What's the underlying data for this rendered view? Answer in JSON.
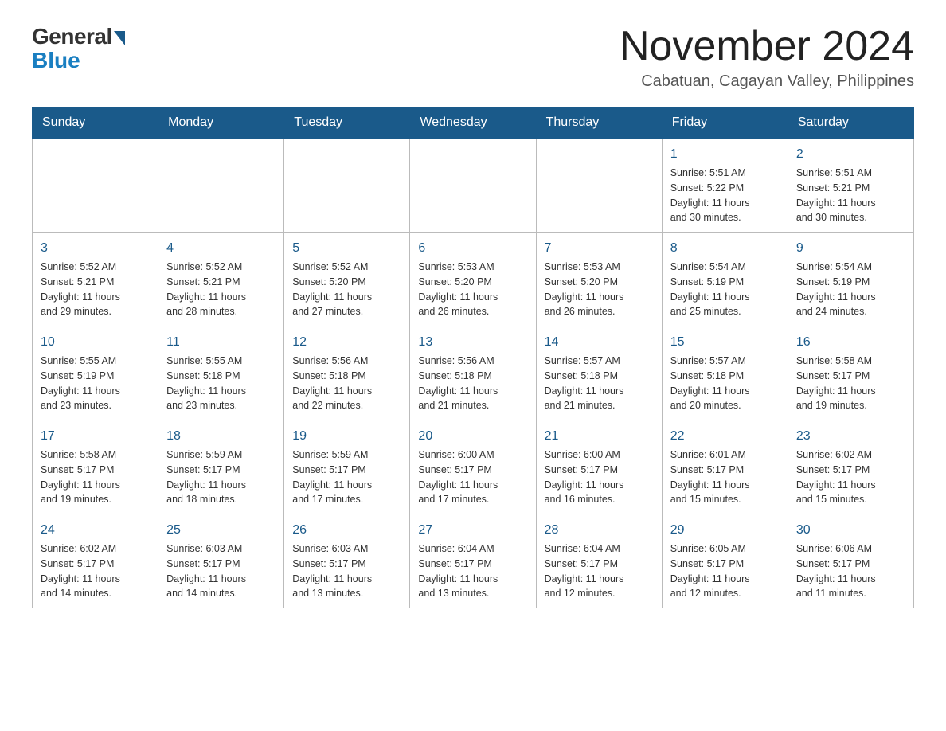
{
  "header": {
    "logo_general": "General",
    "logo_blue": "Blue",
    "month_title": "November 2024",
    "location": "Cabatuan, Cagayan Valley, Philippines"
  },
  "weekdays": [
    "Sunday",
    "Monday",
    "Tuesday",
    "Wednesday",
    "Thursday",
    "Friday",
    "Saturday"
  ],
  "weeks": [
    [
      {
        "day": "",
        "info": ""
      },
      {
        "day": "",
        "info": ""
      },
      {
        "day": "",
        "info": ""
      },
      {
        "day": "",
        "info": ""
      },
      {
        "day": "",
        "info": ""
      },
      {
        "day": "1",
        "info": "Sunrise: 5:51 AM\nSunset: 5:22 PM\nDaylight: 11 hours\nand 30 minutes."
      },
      {
        "day": "2",
        "info": "Sunrise: 5:51 AM\nSunset: 5:21 PM\nDaylight: 11 hours\nand 30 minutes."
      }
    ],
    [
      {
        "day": "3",
        "info": "Sunrise: 5:52 AM\nSunset: 5:21 PM\nDaylight: 11 hours\nand 29 minutes."
      },
      {
        "day": "4",
        "info": "Sunrise: 5:52 AM\nSunset: 5:21 PM\nDaylight: 11 hours\nand 28 minutes."
      },
      {
        "day": "5",
        "info": "Sunrise: 5:52 AM\nSunset: 5:20 PM\nDaylight: 11 hours\nand 27 minutes."
      },
      {
        "day": "6",
        "info": "Sunrise: 5:53 AM\nSunset: 5:20 PM\nDaylight: 11 hours\nand 26 minutes."
      },
      {
        "day": "7",
        "info": "Sunrise: 5:53 AM\nSunset: 5:20 PM\nDaylight: 11 hours\nand 26 minutes."
      },
      {
        "day": "8",
        "info": "Sunrise: 5:54 AM\nSunset: 5:19 PM\nDaylight: 11 hours\nand 25 minutes."
      },
      {
        "day": "9",
        "info": "Sunrise: 5:54 AM\nSunset: 5:19 PM\nDaylight: 11 hours\nand 24 minutes."
      }
    ],
    [
      {
        "day": "10",
        "info": "Sunrise: 5:55 AM\nSunset: 5:19 PM\nDaylight: 11 hours\nand 23 minutes."
      },
      {
        "day": "11",
        "info": "Sunrise: 5:55 AM\nSunset: 5:18 PM\nDaylight: 11 hours\nand 23 minutes."
      },
      {
        "day": "12",
        "info": "Sunrise: 5:56 AM\nSunset: 5:18 PM\nDaylight: 11 hours\nand 22 minutes."
      },
      {
        "day": "13",
        "info": "Sunrise: 5:56 AM\nSunset: 5:18 PM\nDaylight: 11 hours\nand 21 minutes."
      },
      {
        "day": "14",
        "info": "Sunrise: 5:57 AM\nSunset: 5:18 PM\nDaylight: 11 hours\nand 21 minutes."
      },
      {
        "day": "15",
        "info": "Sunrise: 5:57 AM\nSunset: 5:18 PM\nDaylight: 11 hours\nand 20 minutes."
      },
      {
        "day": "16",
        "info": "Sunrise: 5:58 AM\nSunset: 5:17 PM\nDaylight: 11 hours\nand 19 minutes."
      }
    ],
    [
      {
        "day": "17",
        "info": "Sunrise: 5:58 AM\nSunset: 5:17 PM\nDaylight: 11 hours\nand 19 minutes."
      },
      {
        "day": "18",
        "info": "Sunrise: 5:59 AM\nSunset: 5:17 PM\nDaylight: 11 hours\nand 18 minutes."
      },
      {
        "day": "19",
        "info": "Sunrise: 5:59 AM\nSunset: 5:17 PM\nDaylight: 11 hours\nand 17 minutes."
      },
      {
        "day": "20",
        "info": "Sunrise: 6:00 AM\nSunset: 5:17 PM\nDaylight: 11 hours\nand 17 minutes."
      },
      {
        "day": "21",
        "info": "Sunrise: 6:00 AM\nSunset: 5:17 PM\nDaylight: 11 hours\nand 16 minutes."
      },
      {
        "day": "22",
        "info": "Sunrise: 6:01 AM\nSunset: 5:17 PM\nDaylight: 11 hours\nand 15 minutes."
      },
      {
        "day": "23",
        "info": "Sunrise: 6:02 AM\nSunset: 5:17 PM\nDaylight: 11 hours\nand 15 minutes."
      }
    ],
    [
      {
        "day": "24",
        "info": "Sunrise: 6:02 AM\nSunset: 5:17 PM\nDaylight: 11 hours\nand 14 minutes."
      },
      {
        "day": "25",
        "info": "Sunrise: 6:03 AM\nSunset: 5:17 PM\nDaylight: 11 hours\nand 14 minutes."
      },
      {
        "day": "26",
        "info": "Sunrise: 6:03 AM\nSunset: 5:17 PM\nDaylight: 11 hours\nand 13 minutes."
      },
      {
        "day": "27",
        "info": "Sunrise: 6:04 AM\nSunset: 5:17 PM\nDaylight: 11 hours\nand 13 minutes."
      },
      {
        "day": "28",
        "info": "Sunrise: 6:04 AM\nSunset: 5:17 PM\nDaylight: 11 hours\nand 12 minutes."
      },
      {
        "day": "29",
        "info": "Sunrise: 6:05 AM\nSunset: 5:17 PM\nDaylight: 11 hours\nand 12 minutes."
      },
      {
        "day": "30",
        "info": "Sunrise: 6:06 AM\nSunset: 5:17 PM\nDaylight: 11 hours\nand 11 minutes."
      }
    ]
  ]
}
